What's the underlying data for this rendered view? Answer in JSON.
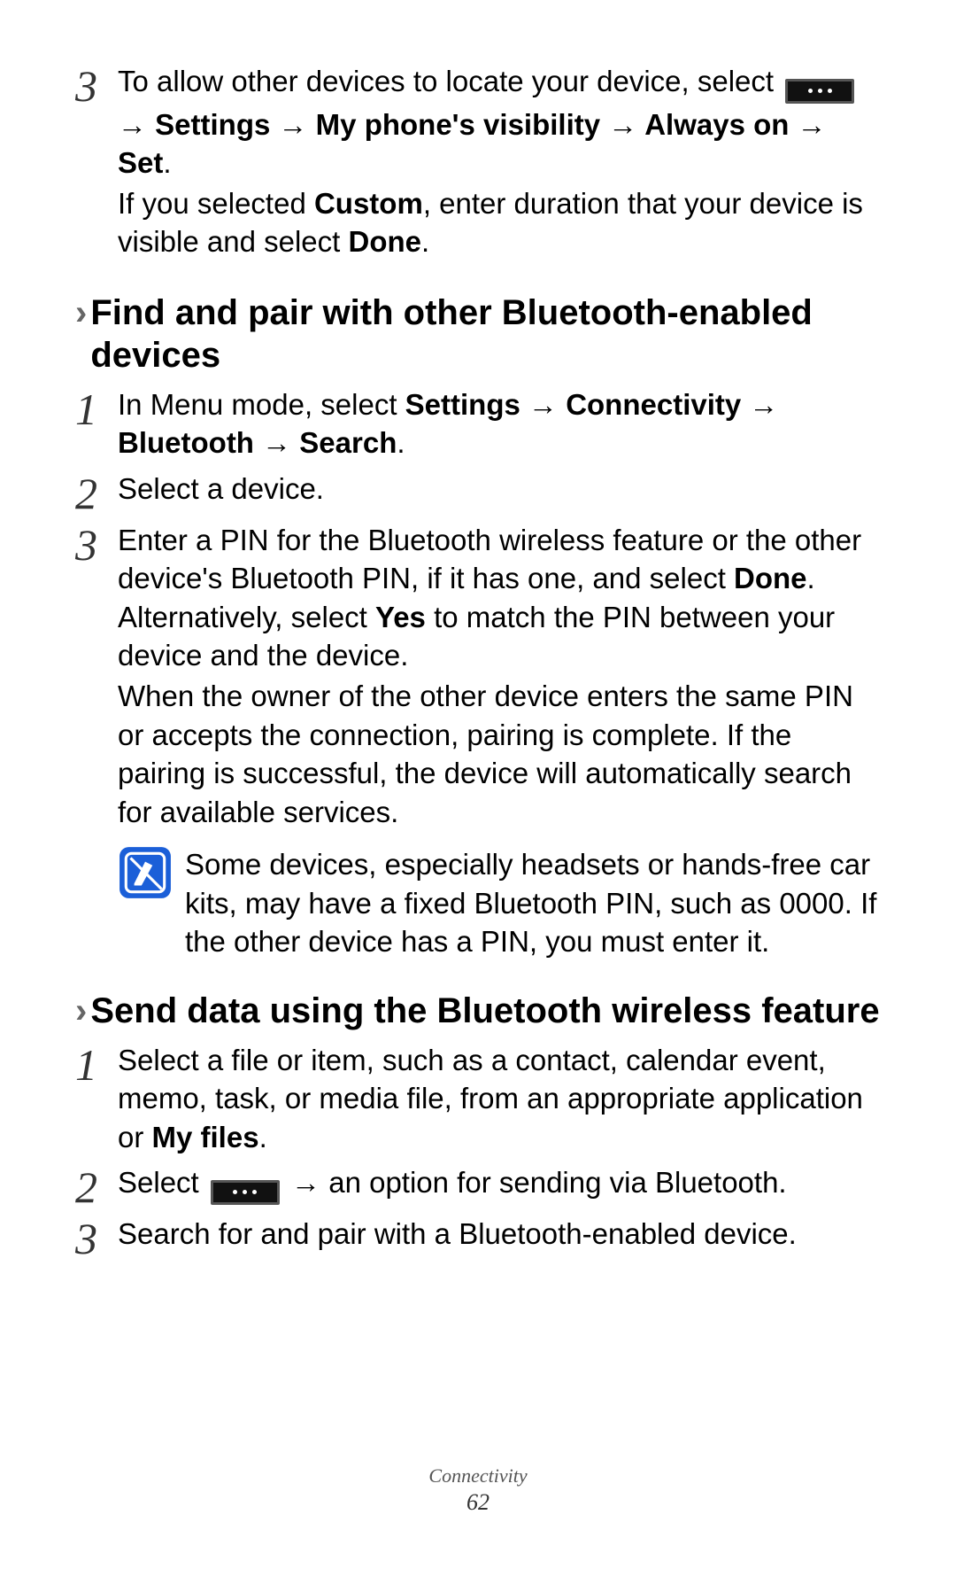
{
  "pre_step": {
    "num": "3",
    "line1_pre": "To allow other devices to locate your device, select ",
    "path": "→ Settings → My phone's visibility → Always on → Set",
    "line2_plain1": "If you selected ",
    "line2_bold1": "Custom",
    "line2_plain2": ", enter duration that your device is visible and select ",
    "line2_bold2": "Done",
    "line2_plain3": "."
  },
  "heading1": "Find and pair with other Bluetooth-enabled devices",
  "sec1": {
    "s1": {
      "num": "1",
      "plain1": "In Menu mode, select ",
      "bold": "Settings → Connectivity → Bluetooth → Search",
      "plain2": "."
    },
    "s2": {
      "num": "2",
      "text": "Select a device."
    },
    "s3": {
      "num": "3",
      "p1a": "Enter a PIN for the Bluetooth wireless feature or the other device's Bluetooth PIN, if it has one, and select ",
      "p1b": "Done",
      "p1c": ". Alternatively, select ",
      "p1d": "Yes",
      "p1e": " to match the PIN between your device and the device.",
      "p2": "When the owner of the other device enters the same PIN or accepts the connection, pairing is complete. If the pairing is successful, the device will automatically search for available services."
    }
  },
  "note_text": "Some devices, especially headsets or hands-free car kits, may have a fixed Bluetooth PIN, such as 0000. If the other device has a PIN, you must enter it.",
  "heading2": "Send data using the Bluetooth wireless feature",
  "sec2": {
    "s1": {
      "num": "1",
      "plain1": "Select a file or item, such as a contact, calendar event, memo, task, or media file, from an appropriate application or ",
      "bold": "My files",
      "plain2": "."
    },
    "s2": {
      "num": "2",
      "pre": "Select ",
      "post": " → an option for sending via Bluetooth."
    },
    "s3": {
      "num": "3",
      "text": "Search for and pair with a Bluetooth-enabled device."
    }
  },
  "footer": {
    "section": "Connectivity",
    "page": "62"
  }
}
